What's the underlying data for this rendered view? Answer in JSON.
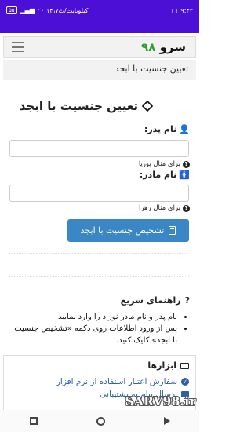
{
  "status_bar": {
    "time": "۹:۴۳",
    "network": "۱۴٫۷کیلوبایت/ث",
    "battery": "۵۵"
  },
  "navbar": {
    "brand_text": "سرو",
    "brand_number": "۹۸"
  },
  "breadcrumb": "تعیین جنسیت با ابجد",
  "main": {
    "title": "تعیین جنسیت با ابجد",
    "father_label": "نام پدر:",
    "father_value": "",
    "father_hint": "برای مثال پوریا",
    "mother_label": "نام مادر:",
    "mother_value": "",
    "mother_hint": "برای مثال زهرا",
    "submit_label": "تشخیص جنسیت با ابجد"
  },
  "guide": {
    "title": "راهنمای سریع",
    "items": [
      "نام پدر و نام مادر نوزاد را وارد نمایید",
      "پس از ورود اطلاعات روی دکمه «تشخیص جنسیت با ابجد» کلیک کنید."
    ]
  },
  "tools": {
    "title": "ابزارها",
    "links": [
      "سفارش اعتبار استفاده از نرم افزار",
      "ارسال پیام به پشتیبانی"
    ]
  },
  "watermark": "SARV98.ir",
  "icons": {
    "title_icon": "cube-icon",
    "father_icon": "male-user-icon",
    "mother_icon": "female-user-icon",
    "hint_icon": "question-circle-icon",
    "submit_icon": "calculator-icon",
    "guide_icon": "question-icon",
    "tools_icon": "monitor-icon"
  },
  "colors": {
    "status_bar": "#4b0fd6",
    "button": "#3b86c4",
    "link": "#2f5fa8",
    "brand_number": "#2e9e2e"
  }
}
